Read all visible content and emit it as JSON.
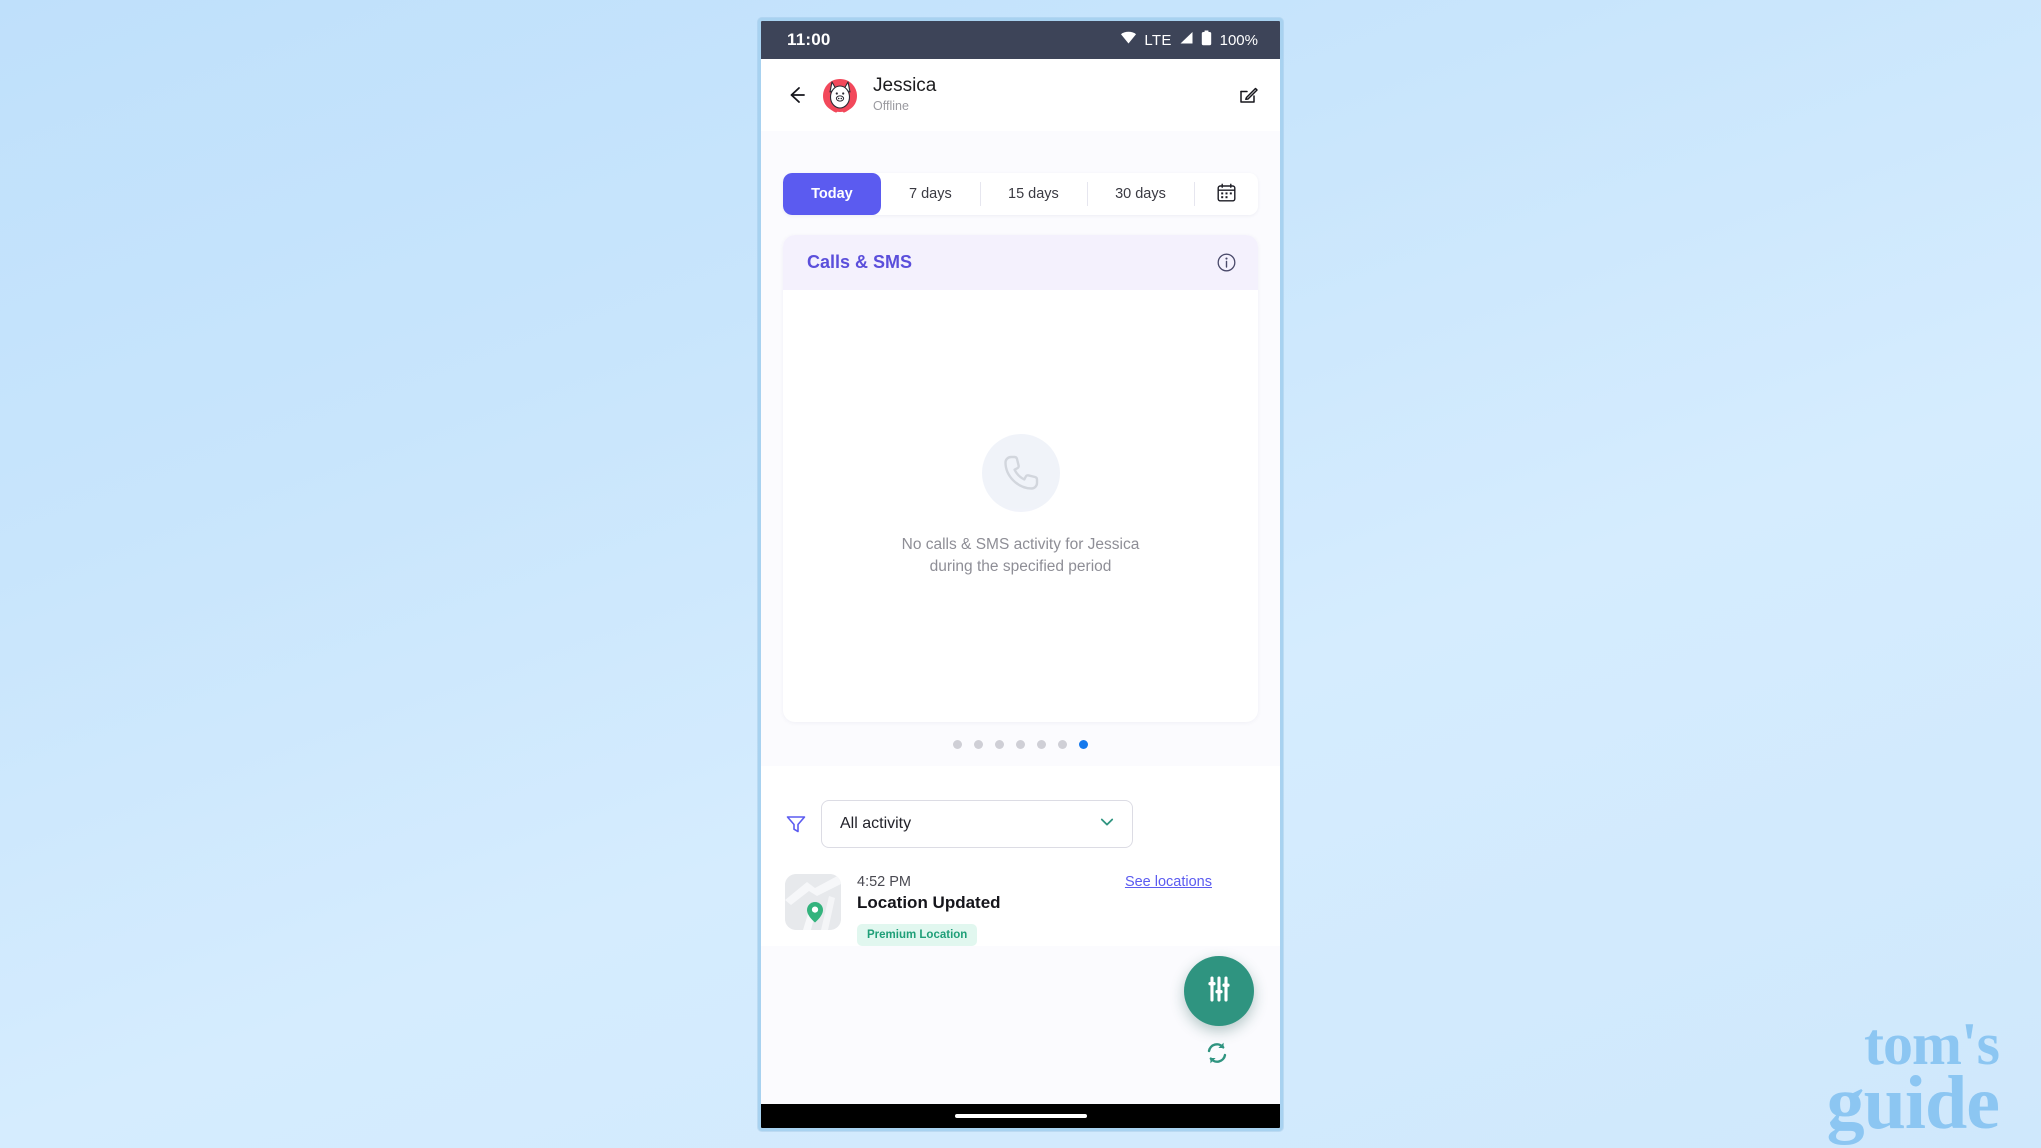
{
  "watermark": {
    "line1": "tom's",
    "line2": "guide"
  },
  "status_bar": {
    "clock": "11:00",
    "network_label": "LTE",
    "battery_percent": "100%",
    "icons": [
      "wifi-icon",
      "signal-icon",
      "battery-icon"
    ]
  },
  "header": {
    "back_icon": "back-arrow-icon",
    "avatar_name": "avatar",
    "profile_name": "Jessica",
    "profile_status": "Offline",
    "edit_icon": "edit-icon"
  },
  "period_tabs": {
    "items": [
      {
        "label": "Today",
        "active": true
      },
      {
        "label": "7 days",
        "active": false
      },
      {
        "label": "15 days",
        "active": false
      },
      {
        "label": "30 days",
        "active": false
      }
    ],
    "calendar_icon": "calendar-icon",
    "active_color": "#5b5bf0"
  },
  "calls_card": {
    "title": "Calls & SMS",
    "info_icon": "info-icon",
    "header_bg": "#f4f1fd",
    "title_color": "#5b4fdb",
    "empty_icon": "phone-icon",
    "empty_line1": "No calls & SMS activity for Jessica",
    "empty_line2": "during the specified period"
  },
  "pagination": {
    "total": 7,
    "active_index": 6,
    "active_color": "#1579ed",
    "inactive_color": "#cfcfd6"
  },
  "filter": {
    "funnel_icon": "filter-icon",
    "selected": "All activity",
    "placeholder": "All activity",
    "chevron_icon": "chevron-down-icon",
    "options": [
      "All activity"
    ]
  },
  "activity": {
    "items": [
      {
        "thumb_icon": "map-pin-icon",
        "time": "4:52 PM",
        "link_label": "See locations",
        "title": "Location Updated",
        "badge": "Premium Location",
        "badge_color": "#1f9f78"
      }
    ]
  },
  "fab": {
    "icon": "sliders-icon",
    "color": "#2f9480",
    "refresh_icon": "refresh-icon"
  },
  "nav_bar": {
    "gesture_pill": "home-indicator"
  }
}
